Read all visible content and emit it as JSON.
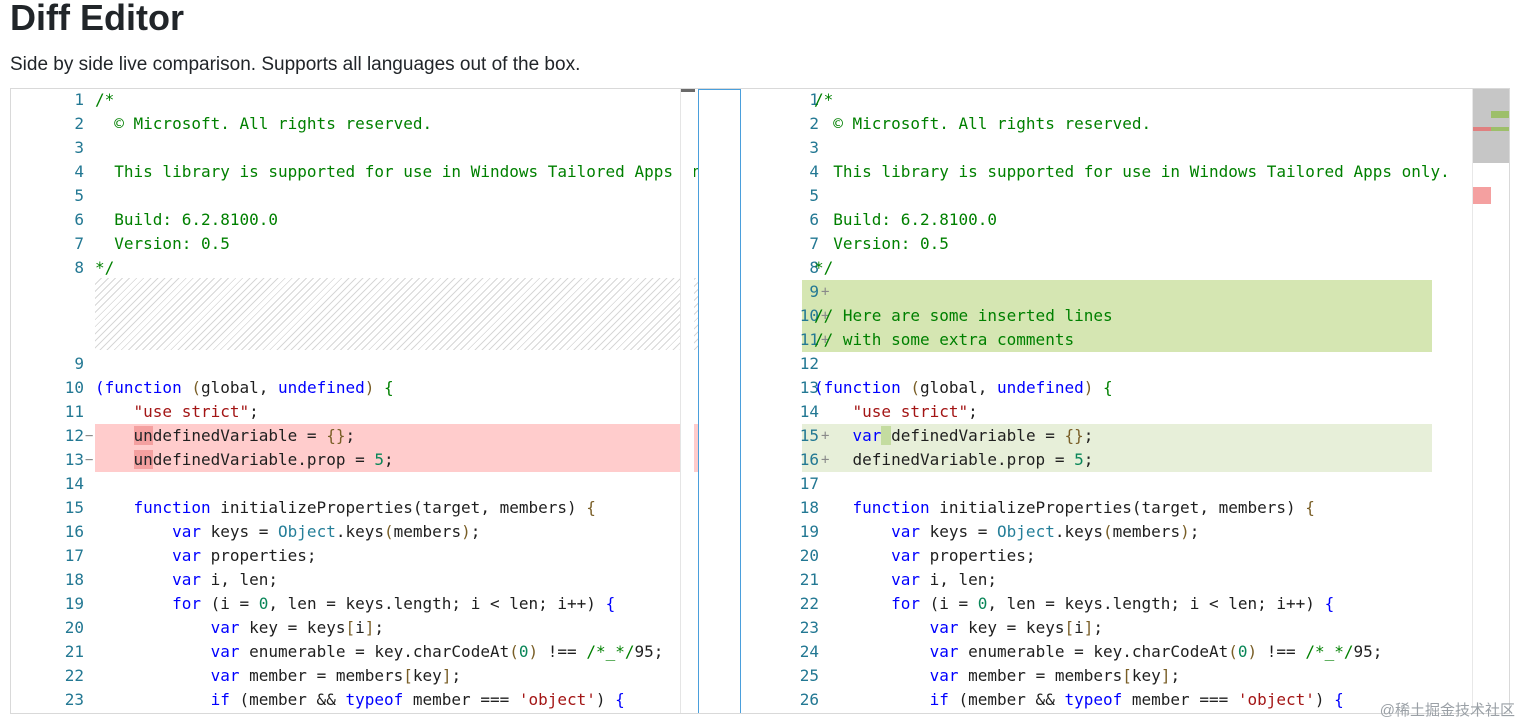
{
  "page": {
    "title": "Diff Editor",
    "subtitle": "Side by side live comparison. Supports all languages out of the box.",
    "watermark": "@稀土掘金技术社区"
  },
  "colors": {
    "deleted_line": "#ffcccc",
    "inserted_line": "#e7efd9",
    "inserted_block": "#d5e6b2",
    "line_number": "#237893",
    "comment": "#008000",
    "keyword": "#0000ff",
    "string": "#a31515",
    "number": "#098658",
    "type": "#267f99",
    "focus_border": "#4a9fdc"
  },
  "original": {
    "lines": [
      {
        "n": "1",
        "tokens": [
          [
            "c-comment",
            "/*"
          ]
        ]
      },
      {
        "n": "2",
        "tokens": [
          [
            "c-comment",
            "  © Microsoft. All rights reserved."
          ]
        ]
      },
      {
        "n": "3",
        "tokens": [
          [
            "c-plain",
            ""
          ]
        ]
      },
      {
        "n": "4",
        "tokens": [
          [
            "c-comment",
            "  This library is supported for use in Windows Tailored Apps only."
          ]
        ]
      },
      {
        "n": "5",
        "tokens": [
          [
            "c-plain",
            ""
          ]
        ]
      },
      {
        "n": "6",
        "tokens": [
          [
            "c-comment",
            "  Build: 6.2.8100.0"
          ]
        ]
      },
      {
        "n": "7",
        "tokens": [
          [
            "c-comment",
            "  Version: 0.5"
          ]
        ]
      },
      {
        "n": "8",
        "tokens": [
          [
            "c-comment",
            "*/"
          ]
        ]
      },
      {
        "n": "9",
        "tokens": [
          [
            "c-plain",
            ""
          ]
        ]
      },
      {
        "n": "10",
        "tokens": [
          [
            "c-keyword",
            "(function"
          ],
          [
            "c-plain",
            " "
          ],
          [
            "c-bracket",
            "("
          ],
          [
            "c-plain",
            "global, "
          ],
          [
            "c-keyword",
            "undefined"
          ],
          [
            "c-bracket",
            ")"
          ],
          [
            "c-plain",
            " "
          ],
          [
            "c-comment",
            "{"
          ]
        ]
      },
      {
        "n": "11",
        "tokens": [
          [
            "c-plain",
            "    "
          ],
          [
            "c-string",
            "\"use strict\""
          ],
          [
            "c-plain",
            ";"
          ]
        ]
      },
      {
        "n": "12",
        "mark": "−",
        "kind": "del",
        "tokens": [
          [
            "c-plain",
            "    "
          ],
          [
            "char-del",
            "un"
          ],
          [
            "c-plain",
            "definedVariable = "
          ],
          [
            "c-bracket",
            "{}"
          ],
          [
            "c-plain",
            ";"
          ]
        ]
      },
      {
        "n": "13",
        "mark": "−",
        "kind": "del",
        "tokens": [
          [
            "c-plain",
            "    "
          ],
          [
            "char-del",
            "un"
          ],
          [
            "c-plain",
            "definedVariable.prop = "
          ],
          [
            "c-number",
            "5"
          ],
          [
            "c-plain",
            ";"
          ]
        ]
      },
      {
        "n": "14",
        "tokens": [
          [
            "c-plain",
            ""
          ]
        ]
      },
      {
        "n": "15",
        "tokens": [
          [
            "c-plain",
            "    "
          ],
          [
            "c-keyword",
            "function"
          ],
          [
            "c-plain",
            " initializeProperties(target, members) "
          ],
          [
            "c-bracket",
            "{"
          ]
        ]
      },
      {
        "n": "16",
        "tokens": [
          [
            "c-plain",
            "        "
          ],
          [
            "c-keyword",
            "var"
          ],
          [
            "c-plain",
            " keys = "
          ],
          [
            "c-type",
            "Object"
          ],
          [
            "c-plain",
            ".keys"
          ],
          [
            "c-bracket",
            "("
          ],
          [
            "c-plain",
            "members"
          ],
          [
            "c-bracket",
            ")"
          ],
          [
            "c-plain",
            ";"
          ]
        ]
      },
      {
        "n": "17",
        "tokens": [
          [
            "c-plain",
            "        "
          ],
          [
            "c-keyword",
            "var"
          ],
          [
            "c-plain",
            " properties;"
          ]
        ]
      },
      {
        "n": "18",
        "tokens": [
          [
            "c-plain",
            "        "
          ],
          [
            "c-keyword",
            "var"
          ],
          [
            "c-plain",
            " i, len;"
          ]
        ]
      },
      {
        "n": "19",
        "tokens": [
          [
            "c-plain",
            "        "
          ],
          [
            "c-keyword",
            "for"
          ],
          [
            "c-plain",
            " (i = "
          ],
          [
            "c-number",
            "0"
          ],
          [
            "c-plain",
            ", len = keys.length; i < len; i++) "
          ],
          [
            "c-keyword",
            "{"
          ]
        ]
      },
      {
        "n": "20",
        "tokens": [
          [
            "c-plain",
            "            "
          ],
          [
            "c-keyword",
            "var"
          ],
          [
            "c-plain",
            " key = keys"
          ],
          [
            "c-bracket",
            "["
          ],
          [
            "c-plain",
            "i"
          ],
          [
            "c-bracket",
            "]"
          ],
          [
            "c-plain",
            ";"
          ]
        ]
      },
      {
        "n": "21",
        "tokens": [
          [
            "c-plain",
            "            "
          ],
          [
            "c-keyword",
            "var"
          ],
          [
            "c-plain",
            " enumerable = key.charCodeAt"
          ],
          [
            "c-bracket",
            "("
          ],
          [
            "c-number",
            "0"
          ],
          [
            "c-bracket",
            ")"
          ],
          [
            "c-plain",
            " !== "
          ],
          [
            "c-comment",
            "/*_*/"
          ],
          [
            "c-plain",
            "95;"
          ]
        ]
      },
      {
        "n": "22",
        "tokens": [
          [
            "c-plain",
            "            "
          ],
          [
            "c-keyword",
            "var"
          ],
          [
            "c-plain",
            " member = members"
          ],
          [
            "c-bracket",
            "["
          ],
          [
            "c-plain",
            "key"
          ],
          [
            "c-bracket",
            "]"
          ],
          [
            "c-plain",
            ";"
          ]
        ]
      },
      {
        "n": "23",
        "tokens": [
          [
            "c-plain",
            "            "
          ],
          [
            "c-keyword",
            "if"
          ],
          [
            "c-plain",
            " (member && "
          ],
          [
            "c-keyword",
            "typeof"
          ],
          [
            "c-plain",
            " member === "
          ],
          [
            "c-string",
            "'object'"
          ],
          [
            "c-plain",
            ") "
          ],
          [
            "c-keyword",
            "{"
          ]
        ]
      }
    ]
  },
  "modified": {
    "lines": [
      {
        "n": "1",
        "tokens": [
          [
            "c-comment",
            "/*"
          ]
        ]
      },
      {
        "n": "2",
        "tokens": [
          [
            "c-comment",
            "  © Microsoft. All rights reserved."
          ]
        ]
      },
      {
        "n": "3",
        "tokens": [
          [
            "c-plain",
            ""
          ]
        ]
      },
      {
        "n": "4",
        "tokens": [
          [
            "c-comment",
            "  This library is supported for use in Windows Tailored Apps only."
          ]
        ]
      },
      {
        "n": "5",
        "tokens": [
          [
            "c-plain",
            ""
          ]
        ]
      },
      {
        "n": "6",
        "tokens": [
          [
            "c-comment",
            "  Build: 6.2.8100.0"
          ]
        ]
      },
      {
        "n": "7",
        "tokens": [
          [
            "c-comment",
            "  Version: 0.5"
          ]
        ]
      },
      {
        "n": "8",
        "tokens": [
          [
            "c-comment",
            "*/"
          ]
        ]
      },
      {
        "n": "9",
        "mark": "+",
        "kind": "insblock",
        "tokens": [
          [
            "c-plain",
            ""
          ]
        ]
      },
      {
        "n": "10",
        "mark": "+",
        "kind": "insblock",
        "tokens": [
          [
            "c-comment",
            "// Here are some inserted lines"
          ]
        ]
      },
      {
        "n": "11",
        "mark": "+",
        "kind": "insblock",
        "tokens": [
          [
            "c-comment",
            "// with some extra comments"
          ]
        ]
      },
      {
        "n": "12",
        "tokens": [
          [
            "c-plain",
            ""
          ]
        ]
      },
      {
        "n": "13",
        "tokens": [
          [
            "c-keyword",
            "(function"
          ],
          [
            "c-plain",
            " "
          ],
          [
            "c-bracket",
            "("
          ],
          [
            "c-plain",
            "global, "
          ],
          [
            "c-keyword",
            "undefined"
          ],
          [
            "c-bracket",
            ")"
          ],
          [
            "c-plain",
            " "
          ],
          [
            "c-comment",
            "{"
          ]
        ]
      },
      {
        "n": "14",
        "tokens": [
          [
            "c-plain",
            "    "
          ],
          [
            "c-string",
            "\"use strict\""
          ],
          [
            "c-plain",
            ";"
          ]
        ]
      },
      {
        "n": "15",
        "mark": "+",
        "kind": "ins",
        "tokens": [
          [
            "c-plain",
            "    "
          ],
          [
            "c-keyword",
            "var"
          ],
          [
            "char-ins",
            " "
          ],
          [
            "c-plain",
            "definedVariable = "
          ],
          [
            "c-bracket",
            "{}"
          ],
          [
            "c-plain",
            ";"
          ]
        ]
      },
      {
        "n": "16",
        "mark": "+",
        "kind": "ins",
        "tokens": [
          [
            "c-plain",
            "    "
          ],
          [
            "c-plain",
            "definedVariable.prop = "
          ],
          [
            "c-number",
            "5"
          ],
          [
            "c-plain",
            ";"
          ]
        ]
      },
      {
        "n": "17",
        "tokens": [
          [
            "c-plain",
            ""
          ]
        ]
      },
      {
        "n": "18",
        "tokens": [
          [
            "c-plain",
            "    "
          ],
          [
            "c-keyword",
            "function"
          ],
          [
            "c-plain",
            " initializeProperties(target, members) "
          ],
          [
            "c-bracket",
            "{"
          ]
        ]
      },
      {
        "n": "19",
        "tokens": [
          [
            "c-plain",
            "        "
          ],
          [
            "c-keyword",
            "var"
          ],
          [
            "c-plain",
            " keys = "
          ],
          [
            "c-type",
            "Object"
          ],
          [
            "c-plain",
            ".keys"
          ],
          [
            "c-bracket",
            "("
          ],
          [
            "c-plain",
            "members"
          ],
          [
            "c-bracket",
            ")"
          ],
          [
            "c-plain",
            ";"
          ]
        ]
      },
      {
        "n": "20",
        "tokens": [
          [
            "c-plain",
            "        "
          ],
          [
            "c-keyword",
            "var"
          ],
          [
            "c-plain",
            " properties;"
          ]
        ]
      },
      {
        "n": "21",
        "tokens": [
          [
            "c-plain",
            "        "
          ],
          [
            "c-keyword",
            "var"
          ],
          [
            "c-plain",
            " i, len;"
          ]
        ]
      },
      {
        "n": "22",
        "tokens": [
          [
            "c-plain",
            "        "
          ],
          [
            "c-keyword",
            "for"
          ],
          [
            "c-plain",
            " (i = "
          ],
          [
            "c-number",
            "0"
          ],
          [
            "c-plain",
            ", len = keys.length; i < len; i++) "
          ],
          [
            "c-keyword",
            "{"
          ]
        ]
      },
      {
        "n": "23",
        "tokens": [
          [
            "c-plain",
            "            "
          ],
          [
            "c-keyword",
            "var"
          ],
          [
            "c-plain",
            " key = keys"
          ],
          [
            "c-bracket",
            "["
          ],
          [
            "c-plain",
            "i"
          ],
          [
            "c-bracket",
            "]"
          ],
          [
            "c-plain",
            ";"
          ]
        ]
      },
      {
        "n": "24",
        "tokens": [
          [
            "c-plain",
            "            "
          ],
          [
            "c-keyword",
            "var"
          ],
          [
            "c-plain",
            " enumerable = key.charCodeAt"
          ],
          [
            "c-bracket",
            "("
          ],
          [
            "c-number",
            "0"
          ],
          [
            "c-bracket",
            ")"
          ],
          [
            "c-plain",
            " !== "
          ],
          [
            "c-comment",
            "/*_*/"
          ],
          [
            "c-plain",
            "95;"
          ]
        ]
      },
      {
        "n": "25",
        "tokens": [
          [
            "c-plain",
            "            "
          ],
          [
            "c-keyword",
            "var"
          ],
          [
            "c-plain",
            " member = members"
          ],
          [
            "c-bracket",
            "["
          ],
          [
            "c-plain",
            "key"
          ],
          [
            "c-bracket",
            "]"
          ],
          [
            "c-plain",
            ";"
          ]
        ]
      },
      {
        "n": "26",
        "tokens": [
          [
            "c-plain",
            "            "
          ],
          [
            "c-keyword",
            "if"
          ],
          [
            "c-plain",
            " (member && "
          ],
          [
            "c-keyword",
            "typeof"
          ],
          [
            "c-plain",
            " member === "
          ],
          [
            "c-string",
            "'object'"
          ],
          [
            "c-plain",
            ") "
          ],
          [
            "c-keyword",
            "{"
          ]
        ]
      }
    ]
  }
}
